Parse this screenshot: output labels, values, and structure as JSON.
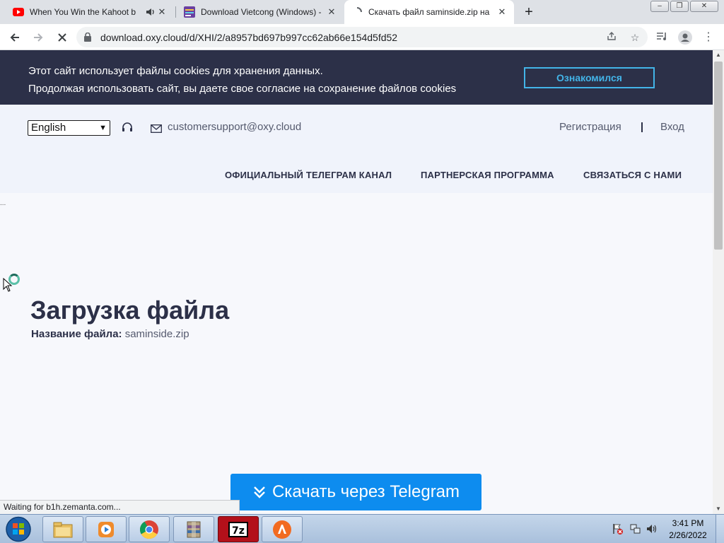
{
  "browser": {
    "tabs": [
      {
        "title": "When You Win the Kahoot b",
        "favicon": "youtube-icon",
        "audio": true
      },
      {
        "title": "Download Vietcong (Windows) -",
        "favicon": "site-icon"
      },
      {
        "title": "Скачать файл saminside.zip на C",
        "favicon": "loading-icon",
        "active": true
      }
    ],
    "window_buttons": [
      "–",
      "❐",
      "✕"
    ],
    "url": "download.oxy.cloud/d/XHI/2/a8957bd697b997cc62ab66e154d5fd52",
    "status": "Waiting for b1h.zemanta.com..."
  },
  "cookie": {
    "line1": "Этот сайт использует файлы cookies для хранения данных.",
    "line2": "Продолжая использовать сайт, вы даете свое согласие на сохранение файлов cookies",
    "button": "Ознакомился"
  },
  "header": {
    "language": "English",
    "email": "customersupport@oxy.cloud",
    "register": "Регистрация",
    "login": "Вход",
    "nav": [
      "ОФИЦИАЛЬНЫЙ ТЕЛЕГРАМ КАНАЛ",
      "ПАРТНЕРСКАЯ ПРОГРАММА",
      "СВЯЗАТЬСЯ С НАМИ"
    ]
  },
  "main": {
    "dots": "...",
    "title": "Загрузка файла",
    "file_label": "Название файла:",
    "file_name": "saminside.zip",
    "telegram_button": "Скачать через Telegram"
  },
  "taskbar": {
    "time": "3:41 PM",
    "date": "2/26/2022",
    "apps": [
      "explorer-icon",
      "media-player-icon",
      "chrome-icon",
      "winrar-icon",
      "7zip-icon",
      "avast-icon"
    ]
  },
  "colors": {
    "cookie_bg": "#2c3048",
    "cookie_btn": "#43b4e8",
    "telegram_btn": "#0d8cef",
    "title": "#2c3048"
  }
}
